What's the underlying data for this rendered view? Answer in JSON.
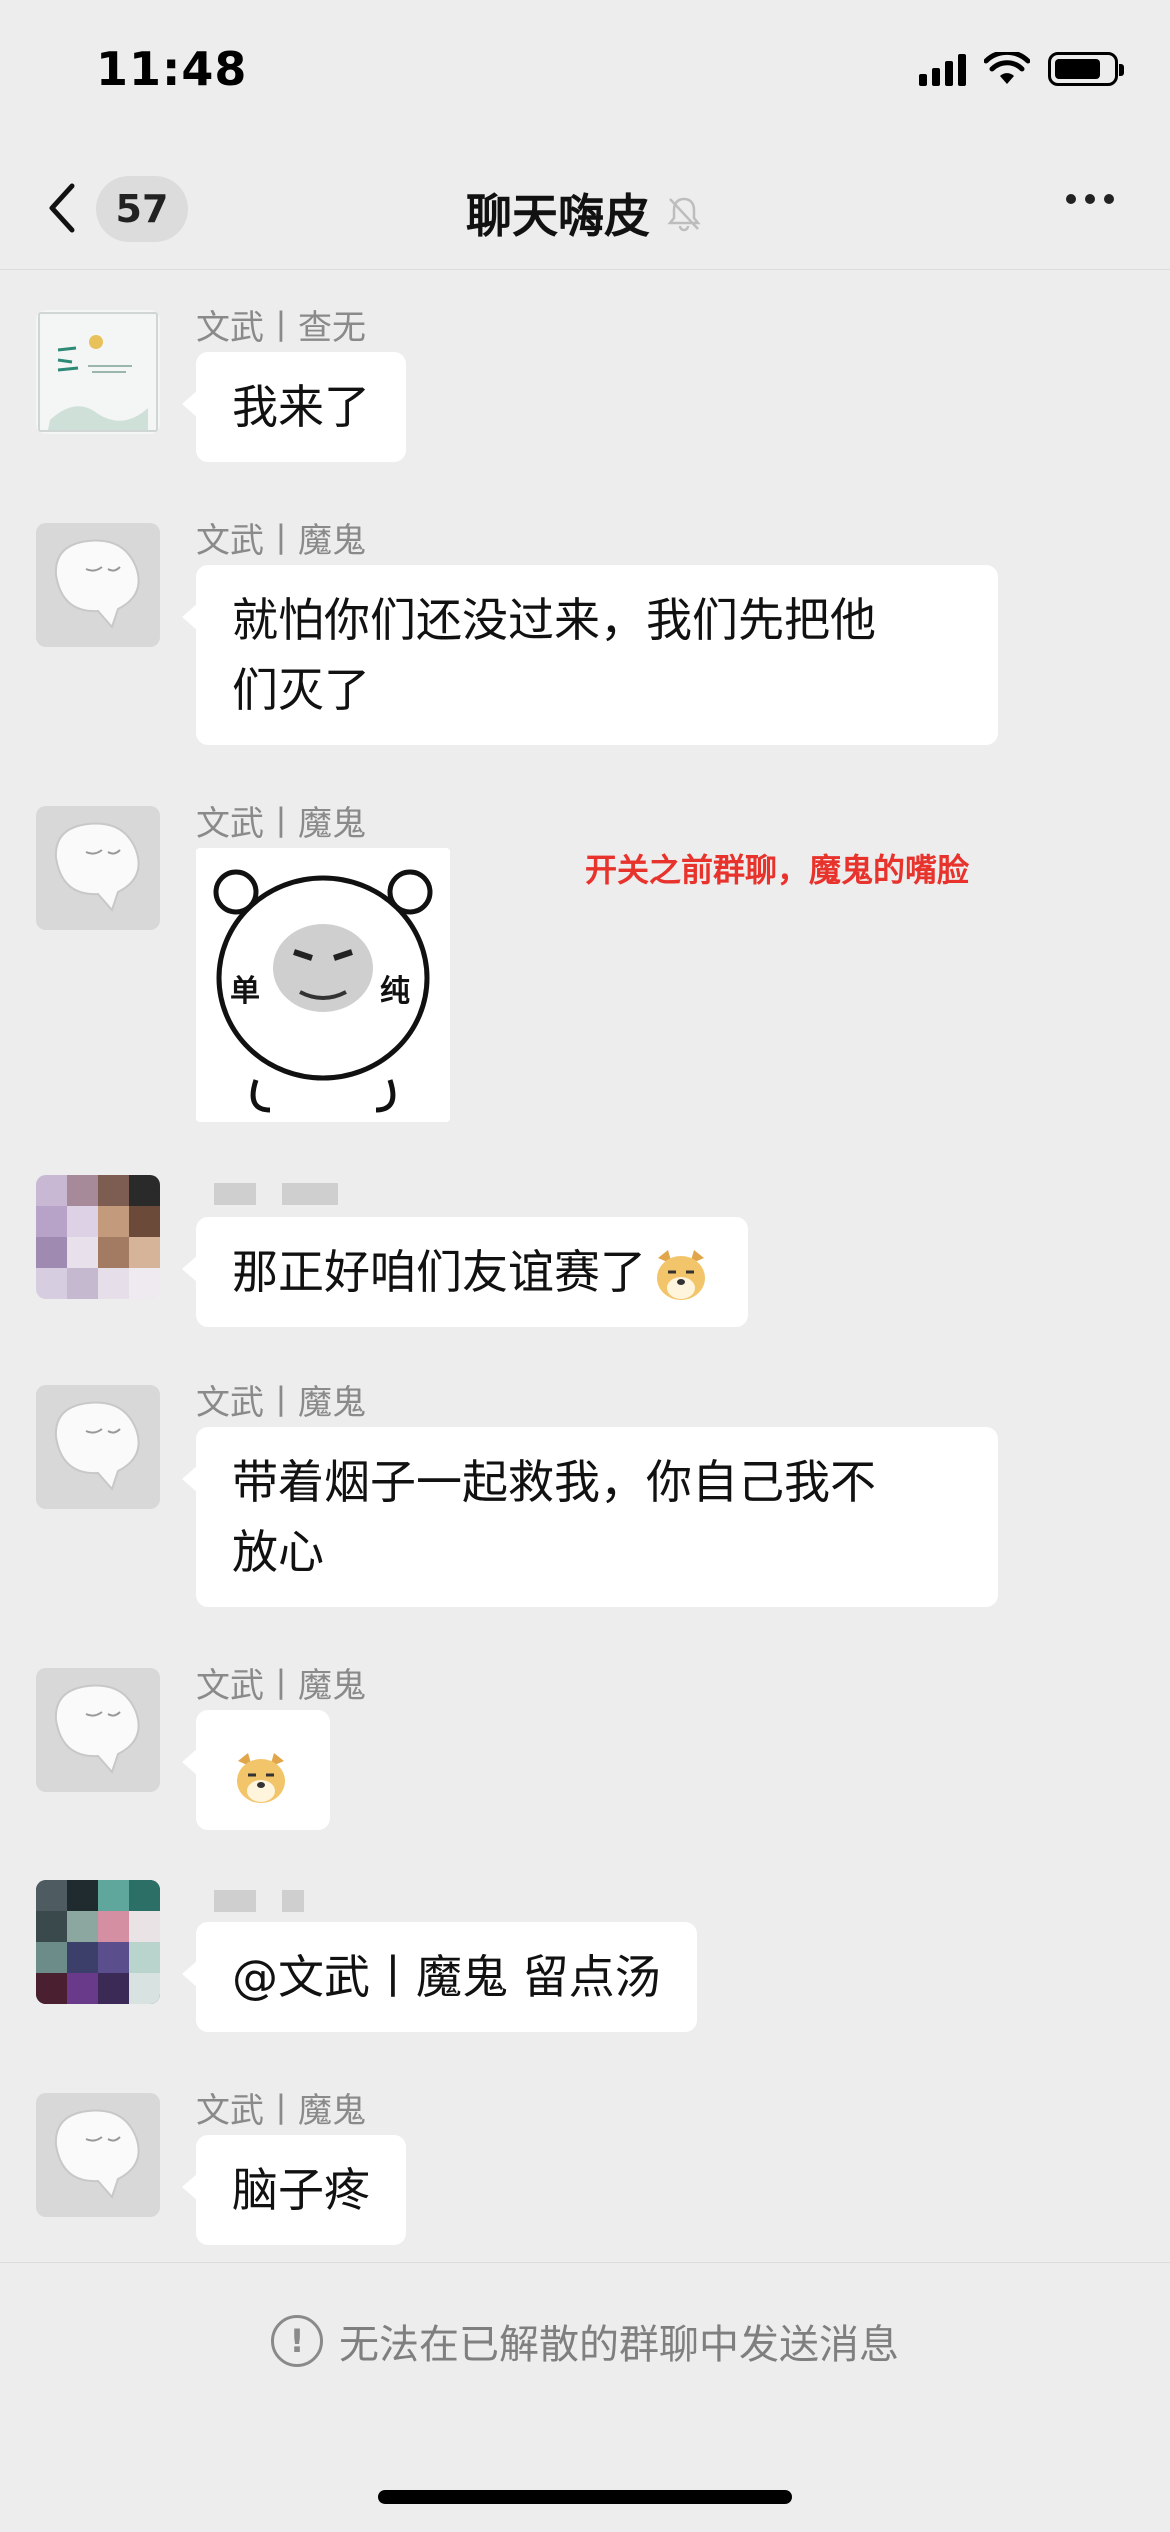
{
  "status_bar": {
    "time": "11:48"
  },
  "nav": {
    "unread_count": "57",
    "title": "聊天嗨皮"
  },
  "messages": [
    {
      "sender": "文武丨查无",
      "text": "我来了"
    },
    {
      "sender": "文武丨魔鬼",
      "text_line1": "就怕你们还没过来，我们先把他",
      "text_line2": "们灭了"
    },
    {
      "sender": "文武丨魔鬼",
      "sticker_text_left": "单",
      "sticker_text_right": "纯"
    },
    {
      "sender": "",
      "text": "那正好咱们友谊赛了"
    },
    {
      "sender": "文武丨魔鬼",
      "text_line1": "带着烟子一起救我，你自己我不",
      "text_line2": "放心"
    },
    {
      "sender": "文武丨魔鬼"
    },
    {
      "sender": "",
      "text": "@文武丨魔鬼 留点汤"
    },
    {
      "sender": "文武丨魔鬼",
      "text": "脑子疼"
    }
  ],
  "annotation": "开关之前群聊，魔鬼的嘴脸",
  "footer": {
    "notice": "无法在已解散的群聊中发送消息"
  },
  "colors": {
    "background": "#ededed",
    "bubble": "#ffffff",
    "annotation": "#e8322c"
  },
  "icons": [
    "back-chevron-icon",
    "bell-muted-icon",
    "more-dots-icon",
    "doge-emoji-icon",
    "info-circle-icon"
  ]
}
